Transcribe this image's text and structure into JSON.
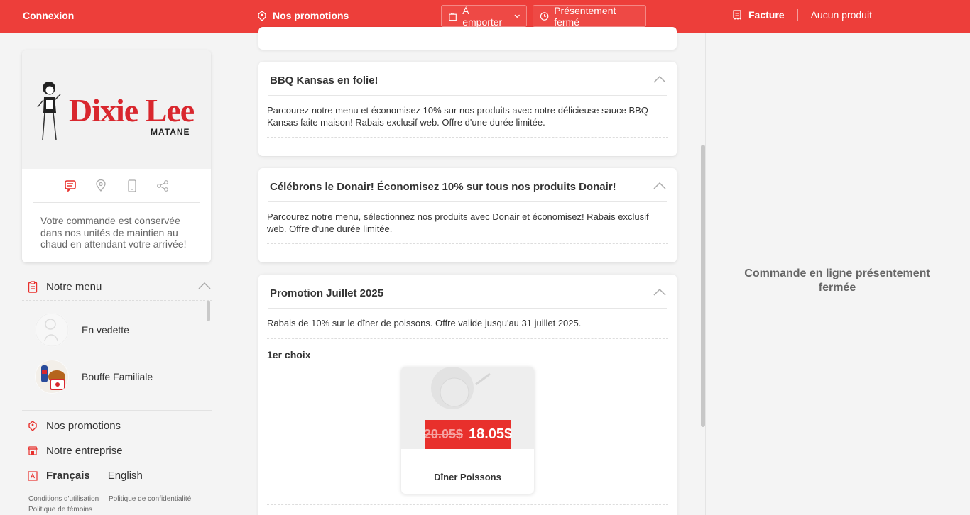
{
  "topbar": {
    "login": "Connexion",
    "promotions": "Nos promotions",
    "order_mode": "À emporter",
    "status": "Présentement fermé",
    "invoice": "Facture",
    "cart": "Aucun produit"
  },
  "store": {
    "logo_name": "Dixie Lee",
    "logo_location": "MATANE",
    "message": "Votre commande est conservée dans nos unités de maintien au chaud en attendant votre arrivée!"
  },
  "menu": {
    "heading": "Notre menu",
    "items": [
      {
        "label": "En vedette"
      },
      {
        "label": "Bouffe Familiale"
      }
    ]
  },
  "footer": {
    "promotions": "Nos promotions",
    "company": "Notre entreprise",
    "lang_current": "Français",
    "lang_other": "English",
    "terms": "Conditions d'utilisation",
    "privacy": "Politique de confidentialité",
    "cookies": "Politique de témoins"
  },
  "promotions": [
    {
      "title": "BBQ Kansas en folie!",
      "description": "Parcourez notre menu et économisez 10% sur nos produits avec notre délicieuse sauce BBQ Kansas faite maison! Rabais exclusif web. Offre d'une durée limitée."
    },
    {
      "title": "Célébrons le Donair! Économisez 10% sur tous nos produits Donair!",
      "description": "Parcourez notre menu, sélectionnez nos produits avec Donair et économisez! Rabais exclusif web. Offre d'une durée limitée."
    },
    {
      "title": "Promotion Juillet 2025",
      "description": "Rabais de 10% sur le dîner de poissons. Offre valide jusqu'au 31 juillet 2025.",
      "choice_label": "1er choix",
      "product": {
        "name": "Dîner Poissons",
        "old_price": "20.05$",
        "new_price": "18.05$"
      }
    }
  ],
  "cart_panel": {
    "message": "Commande en ligne présentement fermée"
  },
  "colors": {
    "brand": "#ed3e3a",
    "price_tag": "#e8302c"
  }
}
